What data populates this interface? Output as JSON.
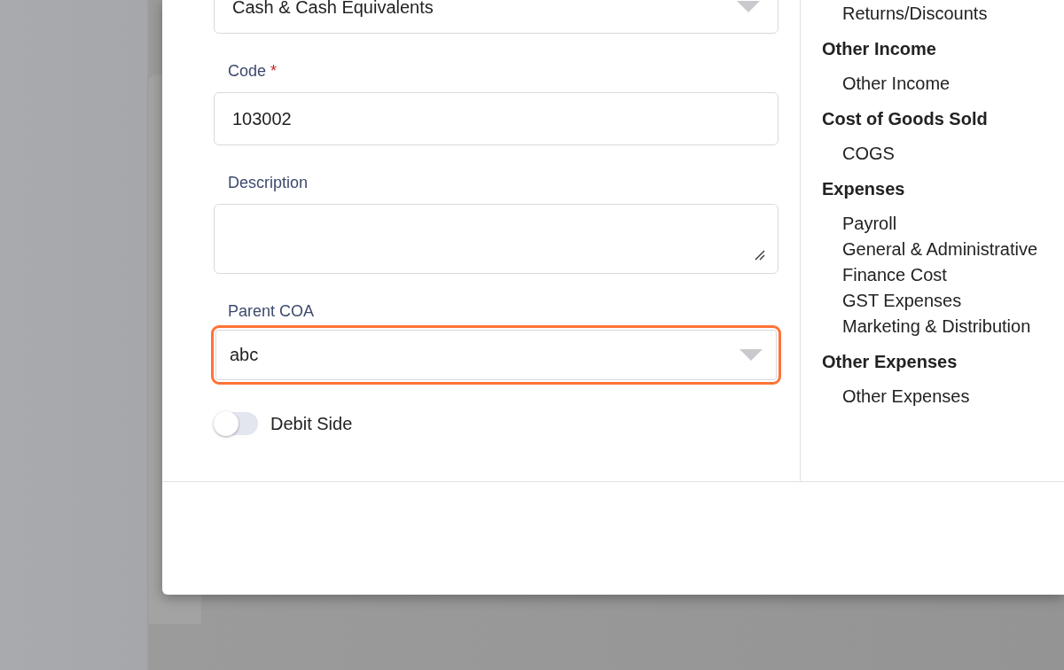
{
  "form": {
    "fields": [
      {
        "kind": "select",
        "value": "Cash & Cash Equivalents",
        "highlighted": false
      },
      {
        "kind": "text",
        "label": "Code",
        "required_mark": "*",
        "value": "103002",
        "highlighted": false
      },
      {
        "kind": "textarea",
        "label": "Description",
        "highlighted": false
      },
      {
        "kind": "select",
        "label": "Parent COA",
        "value": "abc",
        "highlighted": true
      }
    ],
    "toggle": {
      "label": "Debit Side",
      "on": false
    }
  },
  "account_groups": [
    {
      "items": [
        "Returns/Discounts"
      ]
    },
    {
      "heading": "Other Income",
      "items": [
        "Other Income"
      ]
    },
    {
      "heading": "Cost of Goods Sold",
      "items": [
        "COGS"
      ]
    },
    {
      "heading": "Expenses",
      "items": [
        "Payroll",
        "General & Administrative",
        "Finance Cost",
        "GST Expenses",
        "Marketing & Distribution"
      ]
    },
    {
      "heading": "Other Expenses",
      "items": [
        "Other Expenses"
      ]
    }
  ]
}
